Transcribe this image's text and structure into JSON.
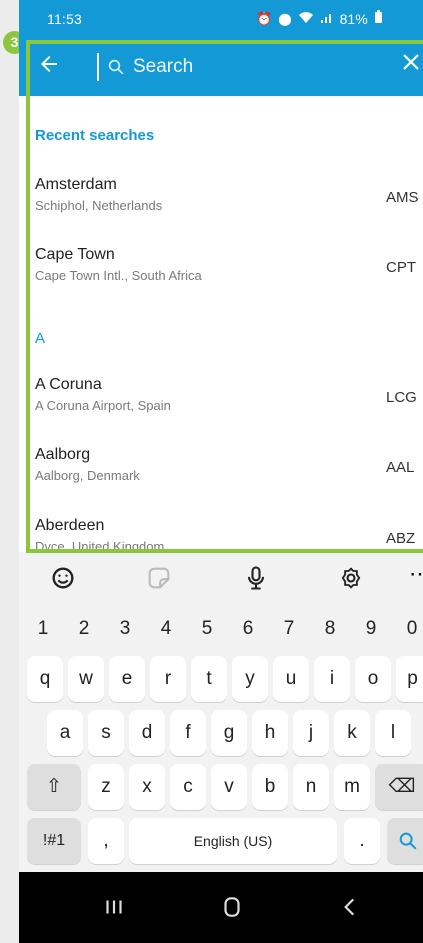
{
  "status": {
    "time": "11:53",
    "carrier_text": "Vo)\nLTE1",
    "battery": "81%"
  },
  "header": {
    "search_placeholder": "Search",
    "back_icon": "arrow-left-icon",
    "close_icon": "close-icon"
  },
  "annotation_badge": "3",
  "recent": {
    "title": "Recent searches",
    "items": [
      {
        "name": "Amsterdam",
        "subtitle": "Schiphol, Netherlands",
        "code": "AMS"
      },
      {
        "name": "Cape Town",
        "subtitle": "Cape Town Intl., South Africa",
        "code": "CPT"
      }
    ]
  },
  "alphabet": {
    "letter": "A",
    "items": [
      {
        "name": "A Coruna",
        "subtitle": "A Coruna Airport, Spain",
        "code": "LCG"
      },
      {
        "name": "Aalborg",
        "subtitle": "Aalborg, Denmark",
        "code": "AAL"
      },
      {
        "name": "Aberdeen",
        "subtitle": "Dyce, United Kingdom",
        "code": "ABZ"
      }
    ]
  },
  "keyboard": {
    "toolbar_icons": [
      "emoji-icon",
      "sticker-icon",
      "mic-icon",
      "settings-icon",
      "more-icon"
    ],
    "row_numbers": [
      "1",
      "2",
      "3",
      "4",
      "5",
      "6",
      "7",
      "8",
      "9",
      "0"
    ],
    "row1": [
      "q",
      "w",
      "e",
      "r",
      "t",
      "y",
      "u",
      "i",
      "o",
      "p"
    ],
    "row2": [
      "a",
      "s",
      "d",
      "f",
      "g",
      "h",
      "j",
      "k",
      "l"
    ],
    "row3": [
      "z",
      "x",
      "c",
      "v",
      "b",
      "n",
      "m"
    ],
    "shift_label": "⇧",
    "backspace_label": "⌫",
    "symbols_label": "!#1",
    "comma_label": ",",
    "space_label": "English (US)",
    "period_label": ".",
    "search_label": "search-icon"
  },
  "nav": {
    "recents_icon": "recents-icon",
    "home_icon": "home-icon",
    "back_icon": "back-nav-icon"
  },
  "colors": {
    "primary": "#139ad6",
    "highlight": "#8cc63f",
    "keyboard_bg": "#f2f2f2"
  }
}
